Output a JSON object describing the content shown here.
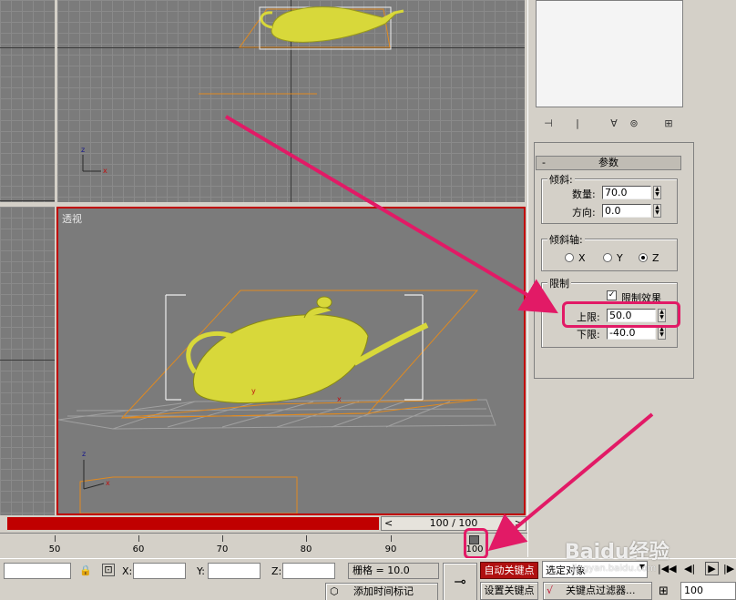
{
  "viewports": {
    "perspective_label": "透视"
  },
  "params": {
    "section_title": "参数",
    "collapse_symbol": "-",
    "taper_group": "倾斜:",
    "amount_label": "数量:",
    "amount_value": "70.0",
    "direction_label": "方向:",
    "direction_value": "0.0",
    "axis_group": "倾斜轴:",
    "axis_x": "X",
    "axis_y": "Y",
    "axis_z": "Z",
    "axis_selected": "Z",
    "limit_group": "限制",
    "limit_effect_label": "限制效果",
    "limit_effect_checked": true,
    "upper_label": "上限:",
    "upper_value": "50.0",
    "lower_label": "下限:",
    "lower_value": "-40.0"
  },
  "toolbar_icons": [
    "pin-stack-icon",
    "show-end-result-icon",
    "make-unique-icon",
    "remove-modifier-icon",
    "configure-modifier-sets-icon"
  ],
  "timeline": {
    "frame_display": "100 / 100",
    "ticks": [
      "50",
      "60",
      "70",
      "80",
      "90",
      "100"
    ],
    "current_frame": "100"
  },
  "status": {
    "x_label": "X:",
    "y_label": "Y:",
    "z_label": "Z:",
    "grid_text": "栅格 = 10.0",
    "auto_key": "自动关键点",
    "set_key": "设置关键点",
    "selection_dropdown": "选定对象",
    "key_filters": "关键点过滤器...",
    "add_time_tag": "添加时间标记",
    "frame_field": "100",
    "watermark_logo": "Baidu经验",
    "watermark_url": "jingyan.baidu.com"
  },
  "colors": {
    "viewport_bg": "#7b7b7b",
    "active_border": "#c00000",
    "teapot": "#d8d83a",
    "highlight": "#e21a66",
    "auto_key_bg": "#b01010",
    "timebar_red": "#c00000"
  }
}
